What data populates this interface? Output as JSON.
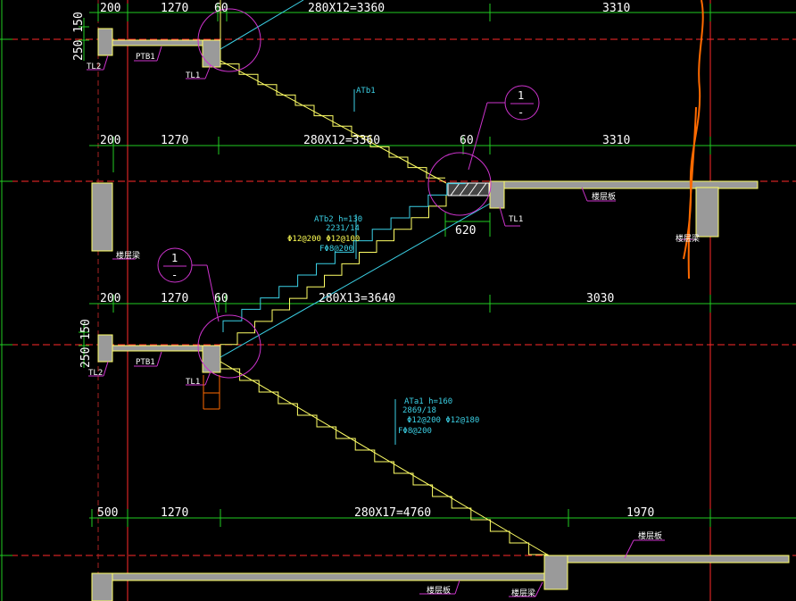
{
  "colors": {
    "background": "#000000",
    "axis": "#ff2a2a",
    "dimension": "#22cc22",
    "outline": "#ffff66",
    "slab": "#9a9a9a",
    "leader": "#cc33cc",
    "rebar_text": "#3bd1e6",
    "stair_line": "#00c8ff",
    "break_line": "#ff6a00"
  },
  "dims_row1": [
    "200",
    "1270",
    "60",
    "280X12=3360",
    "3310"
  ],
  "dims_row2": [
    "200",
    "1270",
    "280X12=3360",
    "60",
    "3310"
  ],
  "dims_row3": [
    "200",
    "1270",
    "60",
    "280X13=3640",
    "3030"
  ],
  "dims_row4": [
    "500",
    "1270",
    "280X17=4760",
    "1970"
  ],
  "dim_620": "620",
  "side_dims_top": "250 150",
  "side_dims_mid": "250 150",
  "labels": {
    "tl2_top": "TL2",
    "ptb1_top": "PTB1",
    "tl1_top": "TL1",
    "tl1_mid": "TL1",
    "tl2_mid": "TL2",
    "ptb1_mid": "PTB1",
    "tl1_low": "TL1",
    "atb1": "ATb1",
    "slab_mid_right": "楼层板",
    "beam_mid_right": "楼层梁",
    "beam_mid_left": "楼层梁",
    "slab_bottom_right": "楼层板",
    "slab_bottom_left": "楼层板",
    "beam_bottom": "楼层梁"
  },
  "atb2": [
    "ATb2 h=130",
    "2231/14",
    "Φ12@200 Φ12@100",
    "FΦ8@200"
  ],
  "ata1": [
    "ATa1 h=160",
    "2869/18",
    "Φ12@200 Φ12@180",
    "FΦ8@200"
  ],
  "callout_right": {
    "num": "1",
    "sub": "-"
  },
  "callout_left": {
    "num": "1",
    "sub": "-"
  }
}
